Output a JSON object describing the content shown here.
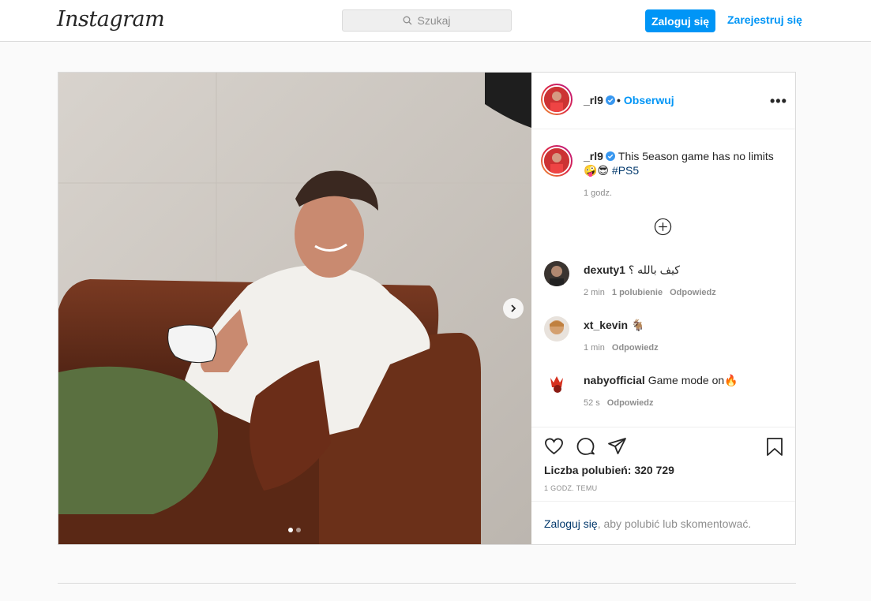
{
  "nav": {
    "logo": "Instagram",
    "search_placeholder": "Szukaj",
    "login_label": "Zaloguj się",
    "register_label": "Zarejestruj się"
  },
  "post": {
    "username": "_rl9",
    "follow_label": "Obserwuj",
    "follow_sep": "•",
    "more_label": "•••",
    "caption_text": "This 5eason game has no limits",
    "caption_emojis": "🤪😎",
    "hashtag": "#PS5",
    "caption_time": "1 godz.",
    "carousel": {
      "current": 1,
      "total": 2
    },
    "comments": [
      {
        "user": "dexuty1",
        "text": "كيف بالله ؟",
        "time": "2 min",
        "likes": "1 polubienie",
        "reply": "Odpowiedz"
      },
      {
        "user": "xt_kevin",
        "text": "🐐",
        "time": "1 min",
        "reply": "Odpowiedz"
      },
      {
        "user": "nabyofficial",
        "text": "Game mode on🔥",
        "time": "52 s",
        "reply": "Odpowiedz"
      }
    ],
    "likes_text": "Liczba polubień: 320 729",
    "time_ago": "1 GODZ. TEMU",
    "login_prompt_link": "Zaloguj się",
    "login_prompt_rest": ", aby polubić lub skomentować."
  },
  "colors": {
    "accent": "#0095f6",
    "border": "#dbdbdb",
    "muted": "#8e8e8e"
  }
}
